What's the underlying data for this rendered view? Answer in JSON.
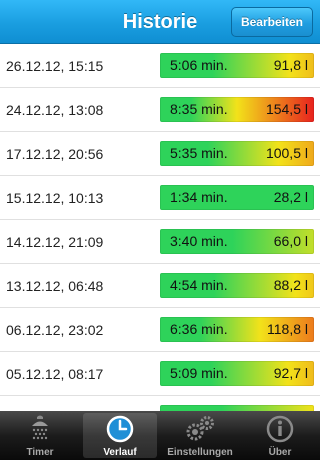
{
  "navbar": {
    "title": "Historie",
    "edit_label": "Bearbeiten"
  },
  "history": [
    {
      "date": "26.12.12, 15:15",
      "duration": "5:06 min.",
      "volume": "91,8 l",
      "level": 0.595
    },
    {
      "date": "24.12.12, 13:08",
      "duration": "8:35 min.",
      "volume": "154,5 l",
      "level": 1.0
    },
    {
      "date": "17.12.12, 20:56",
      "duration": "5:35 min.",
      "volume": "100,5 l",
      "level": 0.65
    },
    {
      "date": "15.12.12, 10:13",
      "duration": "1:34 min.",
      "volume": "28,2 l",
      "level": 0.183
    },
    {
      "date": "14.12.12, 21:09",
      "duration": "3:40 min.",
      "volume": "66,0 l",
      "level": 0.427
    },
    {
      "date": "13.12.12, 06:48",
      "duration": "4:54 min.",
      "volume": "88,2 l",
      "level": 0.571
    },
    {
      "date": "06.12.12, 23:02",
      "duration": "6:36 min.",
      "volume": "118,8 l",
      "level": 0.769
    },
    {
      "date": "05.12.12, 08:17",
      "duration": "5:09 min.",
      "volume": "92,7 l",
      "level": 0.6
    },
    {
      "date": "",
      "duration": "",
      "volume": "",
      "level": 0.5
    }
  ],
  "tabs": [
    {
      "label": "Timer",
      "icon": "shower-icon",
      "active": false
    },
    {
      "label": "Verlauf",
      "icon": "clock-icon",
      "active": true
    },
    {
      "label": "Einstellungen",
      "icon": "gears-icon",
      "active": false
    },
    {
      "label": "Über",
      "icon": "info-icon",
      "active": false
    }
  ],
  "colors": {
    "accent": "#1a9ee0",
    "low": "#2ed35a",
    "mid": "#f2e21a",
    "high": "#e8221e"
  }
}
